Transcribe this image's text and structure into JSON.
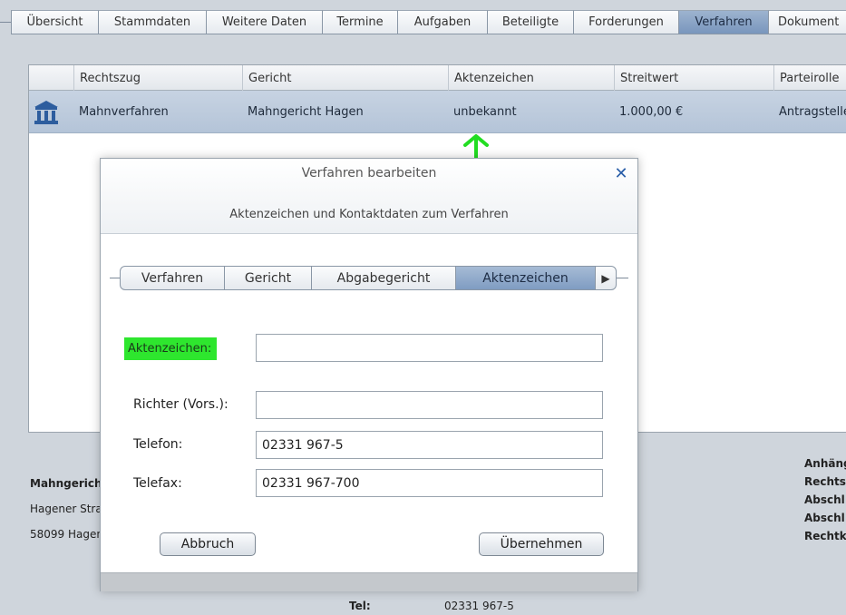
{
  "top_tabs": [
    {
      "label": "Übersicht"
    },
    {
      "label": "Stammdaten"
    },
    {
      "label": "Weitere Daten"
    },
    {
      "label": "Termine"
    },
    {
      "label": "Aufgaben"
    },
    {
      "label": "Beteiligte"
    },
    {
      "label": "Forderungen"
    },
    {
      "label": "Verfahren",
      "active": true
    },
    {
      "label": "Dokument"
    }
  ],
  "table": {
    "headers": {
      "rechtszug": "Rechtszug",
      "gericht": "Gericht",
      "aktenzeichen": "Aktenzeichen",
      "streitwert": "Streitwert",
      "parteirolle": "Parteirolle"
    },
    "rows": [
      {
        "icon": "court-building-icon",
        "rechtszug": "Mahnverfahren",
        "gericht": "Mahngericht Hagen",
        "aktenzeichen": "unbekannt",
        "streitwert": "1.000,00 €",
        "parteirolle": "Antragstelle"
      }
    ]
  },
  "background_info": {
    "court_name": "Mahngerich",
    "street": "Hagener Stra",
    "city": "58099 Hagen",
    "right_labels": [
      "Anhäng",
      "Rechts",
      "Abschl",
      "Abschl",
      "Rechtk"
    ],
    "tel_label": "Tel:",
    "tel_value": "02331 967-5"
  },
  "dialog": {
    "title": "Verfahren bearbeiten",
    "close_icon": "close-icon",
    "subtitle": "Aktenzeichen und Kontaktdaten zum Verfahren",
    "tabs": [
      {
        "label": "Verfahren"
      },
      {
        "label": "Gericht"
      },
      {
        "label": "Abgabegericht"
      },
      {
        "label": "Aktenzeichen",
        "active": true
      }
    ],
    "tab_scroll_icon": "triangle-right-icon",
    "fields": {
      "aktenzeichen": {
        "label": "Aktenzeichen:",
        "value": ""
      },
      "richter": {
        "label": "Richter (Vors.):",
        "value": ""
      },
      "telefon": {
        "label": "Telefon:",
        "value": "02331 967-5"
      },
      "telefax": {
        "label": "Telefax:",
        "value": "02331 967-700"
      }
    },
    "buttons": {
      "cancel": "Abbruch",
      "apply": "Übernehmen"
    }
  },
  "colors": {
    "highlight": "#2ee62e",
    "annotation_arrow": "#22dd22",
    "active_tab": "#7996bd",
    "close_icon": "#2a5ea8"
  }
}
